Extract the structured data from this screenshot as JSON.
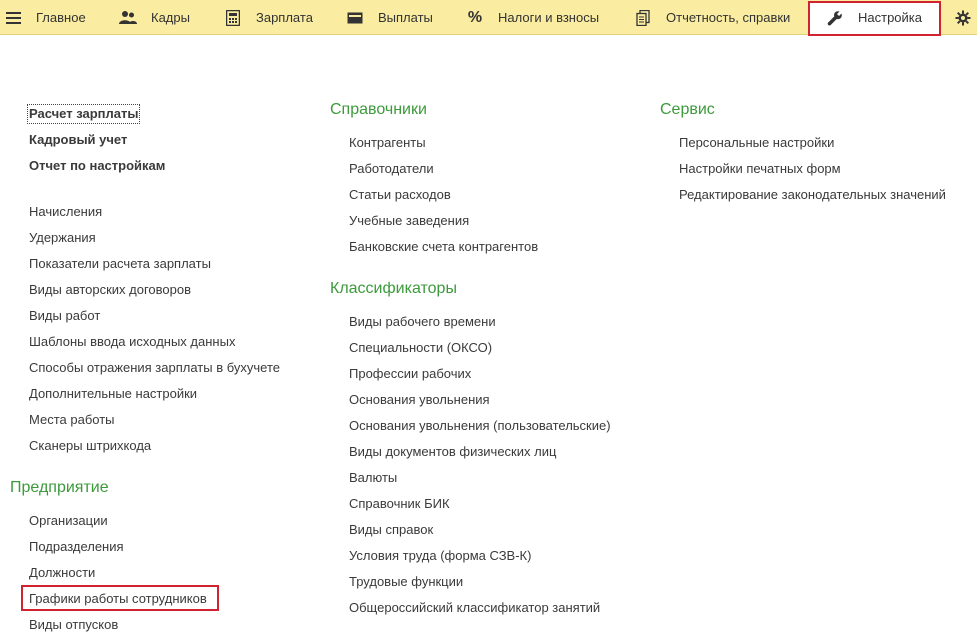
{
  "topbar": {
    "menu_icon": "hamburger-icon",
    "items": [
      {
        "label": "Главное",
        "icon": "menu-icon"
      },
      {
        "label": "Кадры",
        "icon": "users-icon"
      },
      {
        "label": "Зарплата",
        "icon": "calculator-icon"
      },
      {
        "label": "Выплаты",
        "icon": "wallet-icon"
      },
      {
        "label": "Налоги и взносы",
        "icon": "percent-icon"
      },
      {
        "label": "Отчетность, справки",
        "icon": "documents-icon"
      },
      {
        "label": "Настройка",
        "icon": "wrench-icon"
      }
    ],
    "settings_icon": "gear-icon",
    "active_item": "Настройка",
    "accent_color": "#faeda2",
    "highlight_color": "#d0232f"
  },
  "left": {
    "main_links": [
      {
        "label": "Расчет зарплаты"
      },
      {
        "label": "Кадровый учет"
      },
      {
        "label": "Отчет по настройкам"
      }
    ],
    "links": [
      {
        "label": "Начисления"
      },
      {
        "label": "Удержания"
      },
      {
        "label": "Показатели расчета зарплаты"
      },
      {
        "label": "Виды авторских договоров"
      },
      {
        "label": "Виды работ"
      },
      {
        "label": "Шаблоны ввода исходных данных"
      },
      {
        "label": "Способы отражения зарплаты в бухучете"
      },
      {
        "label": "Дополнительные настройки"
      },
      {
        "label": "Места работы"
      },
      {
        "label": "Сканеры штрихкода"
      }
    ],
    "enterprise_title": "Предприятие",
    "enterprise_links": [
      {
        "label": "Организации"
      },
      {
        "label": "Подразделения"
      },
      {
        "label": "Должности"
      },
      {
        "label": "Графики работы сотрудников"
      },
      {
        "label": "Виды отпусков"
      }
    ]
  },
  "middle": {
    "ref_title": "Справочники",
    "ref_links": [
      {
        "label": "Контрагенты"
      },
      {
        "label": "Работодатели"
      },
      {
        "label": "Статьи расходов"
      },
      {
        "label": "Учебные заведения"
      },
      {
        "label": "Банковские счета контрагентов"
      }
    ],
    "class_title": "Классификаторы",
    "class_links": [
      {
        "label": "Виды рабочего времени"
      },
      {
        "label": "Специальности (ОКСО)"
      },
      {
        "label": "Профессии рабочих"
      },
      {
        "label": "Основания увольнения"
      },
      {
        "label": "Основания увольнения (пользовательские)"
      },
      {
        "label": "Виды документов физических лиц"
      },
      {
        "label": "Валюты"
      },
      {
        "label": "Справочник БИК"
      },
      {
        "label": "Виды справок"
      },
      {
        "label": "Условия труда (форма СЗВ-К)"
      },
      {
        "label": "Трудовые функции"
      },
      {
        "label": "Общероссийский классификатор занятий"
      }
    ]
  },
  "right": {
    "service_title": "Сервис",
    "service_links": [
      {
        "label": "Персональные настройки"
      },
      {
        "label": "Настройки печатных форм"
      },
      {
        "label": "Редактирование законодательных значений"
      }
    ]
  }
}
